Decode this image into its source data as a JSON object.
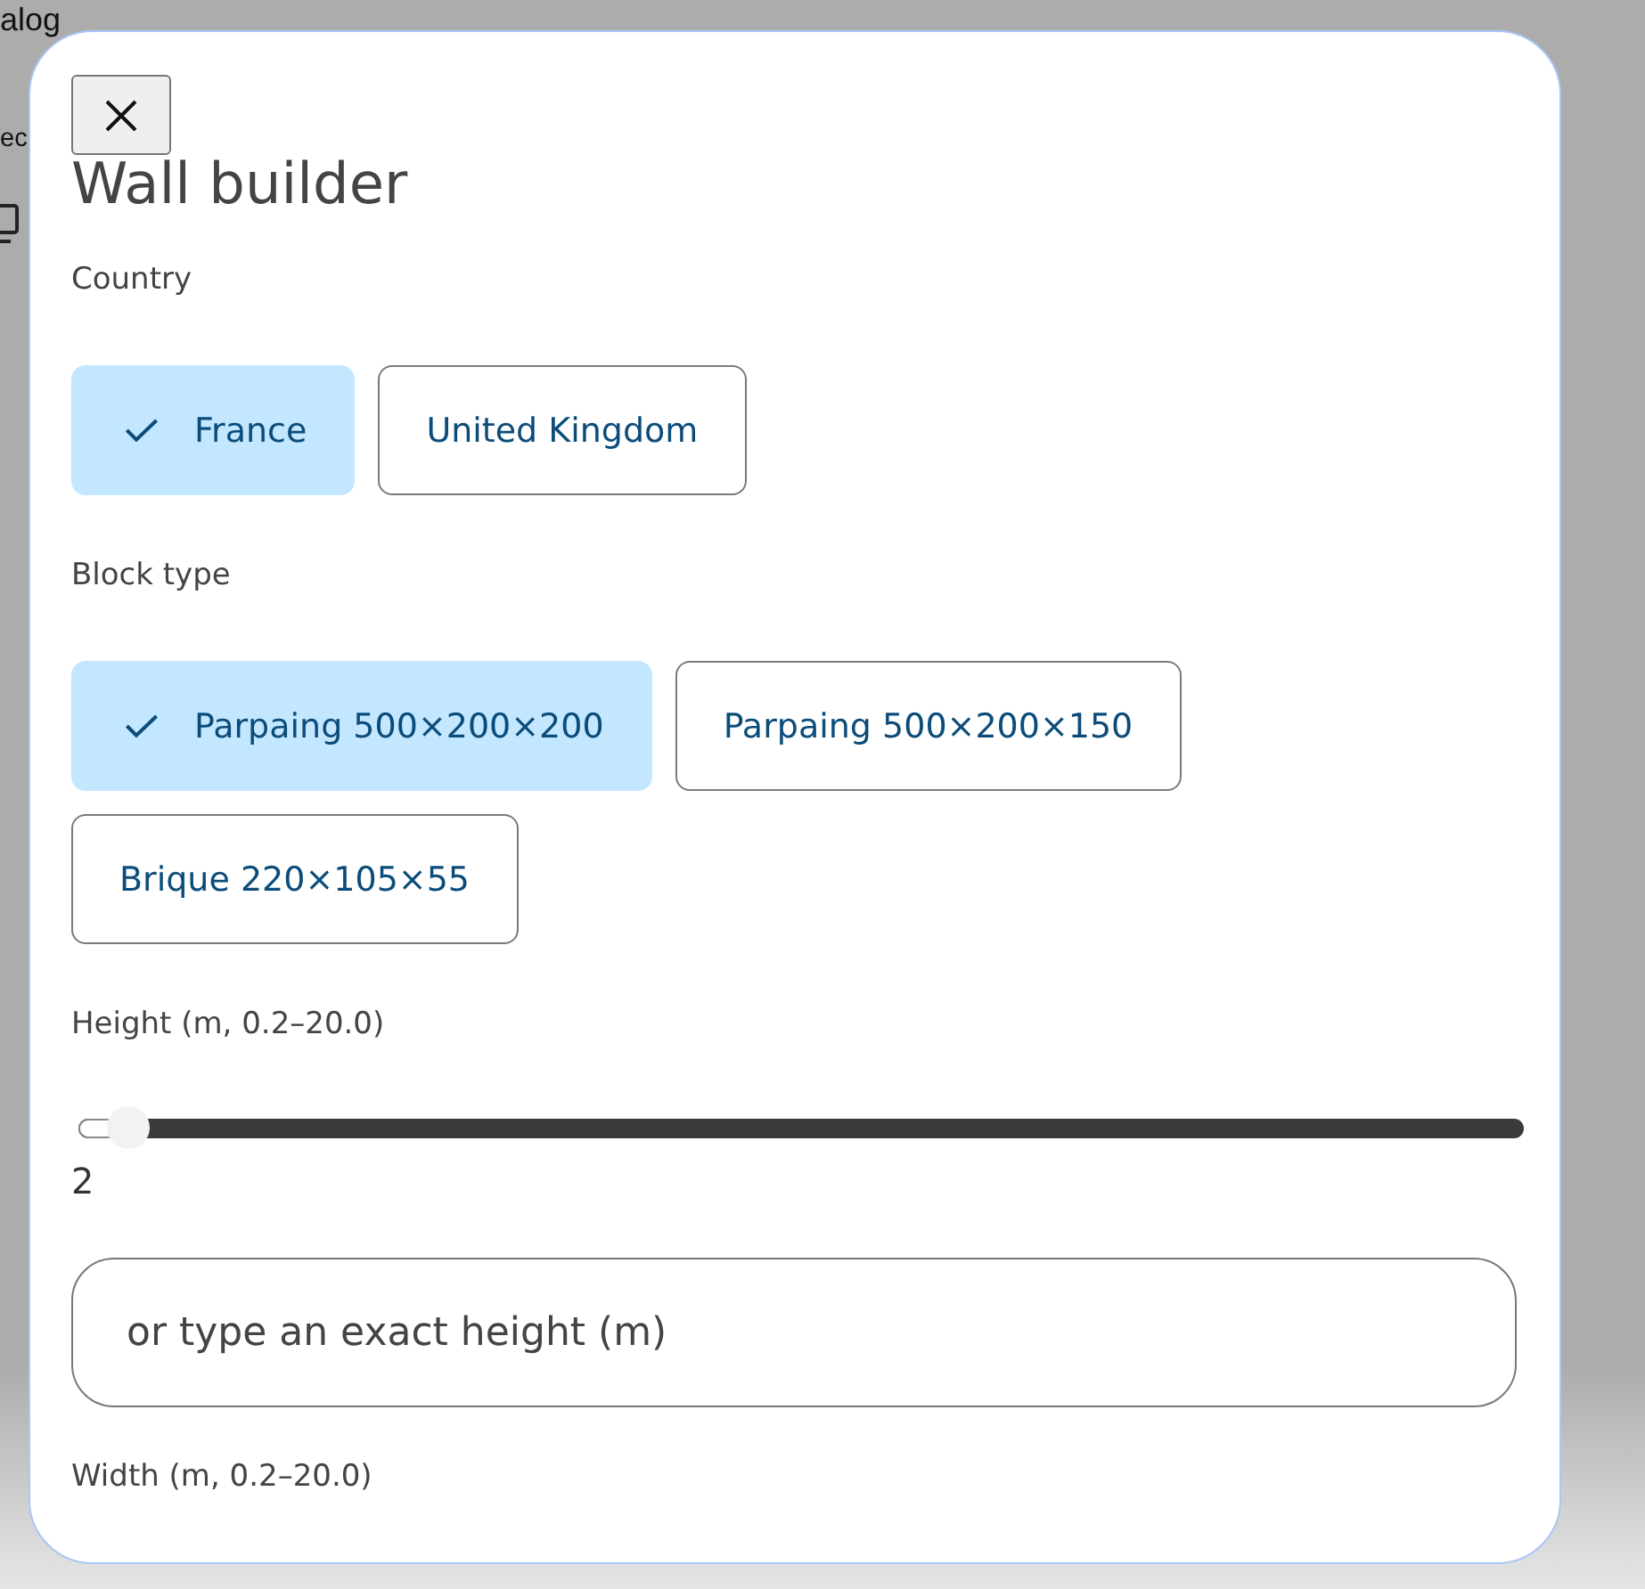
{
  "background_page": {
    "heading_fragment": "alog",
    "text_fragment": "ec"
  },
  "dialog": {
    "title": "Wall builder",
    "sections": [
      {
        "kind": "chips",
        "label": "Country",
        "chips": [
          {
            "label": "France",
            "selected": true
          },
          {
            "label": "United Kingdom",
            "selected": false
          }
        ]
      },
      {
        "kind": "chips",
        "label": "Block type",
        "chips": [
          {
            "label": "Parpaing 500×200×200",
            "selected": true
          },
          {
            "label": "Parpaing 500×200×150",
            "selected": false
          },
          {
            "label": "Brique 220×105×55",
            "selected": false
          }
        ]
      },
      {
        "kind": "slider",
        "label": "Height (m, 0.2–20.0)",
        "level": 0.035,
        "reading": "2",
        "input": {
          "placeholder": "or type an exact height (m)"
        }
      },
      {
        "kind": "label",
        "label": "Width (m, 0.2–20.0)"
      }
    ]
  }
}
